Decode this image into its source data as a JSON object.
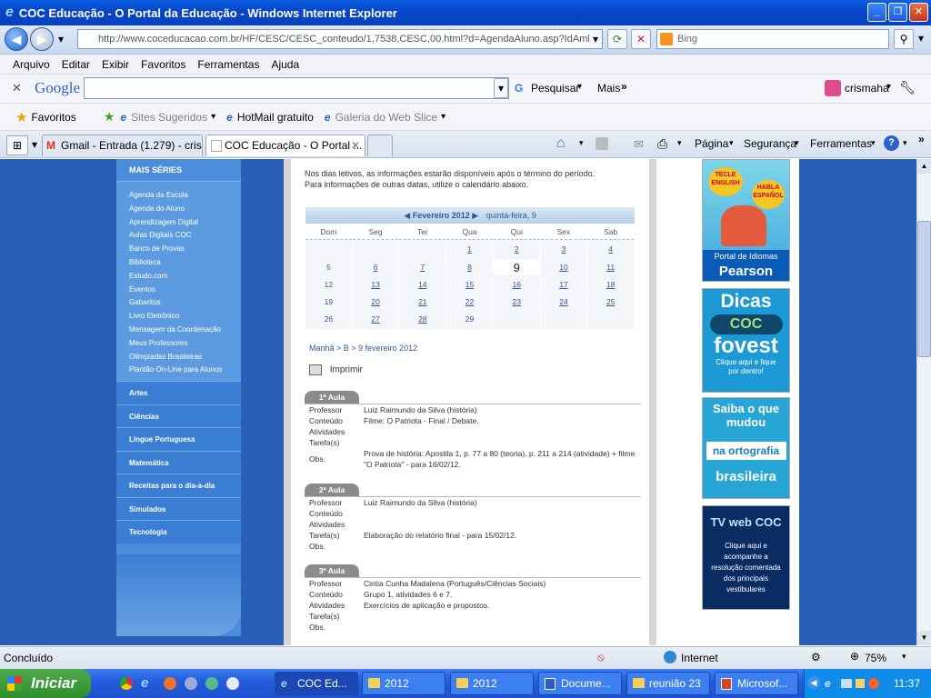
{
  "window": {
    "title": "COC Educação - O Portal da Educação - Windows Internet Explorer"
  },
  "address": {
    "url": "http://www.coceducacao.com.br/HF/CESC/CESC_conteudo/1,7538,CESC,00.html?d=AgendaAluno.asp?IdAmbi",
    "search_placeholder": "Bing"
  },
  "menu": [
    "Arquivo",
    "Editar",
    "Exibir",
    "Favoritos",
    "Ferramentas",
    "Ajuda"
  ],
  "google_toolbar": {
    "logo": "Google",
    "search_button": "Pesquisar",
    "more": "Mais",
    "user": "crismaha"
  },
  "favorites": {
    "favoritos": "Favoritos",
    "sites": "Sites Sugeridos",
    "hotmail": "HotMail gratuito",
    "galeria": "Galeria do Web Slice"
  },
  "tabs": [
    {
      "label": "Gmail - Entrada (1.279) - cris..."
    },
    {
      "label": "COC Educação - O Portal ..."
    }
  ],
  "command_bar": {
    "pagina": "Página",
    "seguranca": "Segurança",
    "ferramentas": "Ferramentas"
  },
  "sidebar": {
    "header": "MAIS SÉRIES",
    "items": [
      "Agenda da Escola",
      "Agenda do Aluno",
      "Aprendizagem Digital",
      "Aulas Digitais COC",
      "Banco de Provas",
      "Biblioteca",
      "Estudo.com",
      "Eventos",
      "Gabaritos",
      "Livro Eletrônico",
      "Mensagem da Coordenação",
      "Meus Professores",
      "Olimpíadas Brasileiras",
      "Plantão On-Line para Alunos"
    ],
    "categories": [
      "Artes",
      "Ciências",
      "Língue Portuguesa",
      "Matemática",
      "Receitas para o dia-a-dia",
      "Simulados",
      "Tecnologia"
    ]
  },
  "main": {
    "intro1": "Nos dias letivos, as informações estarão disponíveis após o término do período.",
    "intro2": "Para informações de outras datas, utilize o calendário abaixo.",
    "calendar": {
      "month": "Fevereiro 2012",
      "selected": "quinta-feira, 9",
      "weekdays": [
        "Dom",
        "Seg",
        "Ter",
        "Qua",
        "Qui",
        "Sex",
        "Sab"
      ],
      "weeks": [
        [
          "",
          "",
          "",
          "1",
          "2",
          "3",
          "4"
        ],
        [
          "5",
          "6",
          "7",
          "8",
          "9",
          "10",
          "11"
        ],
        [
          "12",
          "13",
          "14",
          "15",
          "16",
          "17",
          "18"
        ],
        [
          "19",
          "20",
          "21",
          "22",
          "23",
          "24",
          "25"
        ],
        [
          "26",
          "27",
          "28",
          "29",
          "",
          "",
          ""
        ]
      ]
    },
    "breadcrumb": "Manhã > B > 9 fevereiro 2012",
    "print": "Imprimir",
    "labels": {
      "professor": "Professor",
      "conteudo": "Conteúdo",
      "atividades": "Atividades",
      "tarefas": "Tarefa(s)",
      "obs": "Obs."
    },
    "aulas": [
      {
        "title": "1ª Aula",
        "professor": "Luiz Raimundo da Silva (história)",
        "conteudo": "Filme: O Patriota - Final / Debate.",
        "atividades": "",
        "tarefas": "",
        "obs": "Prova de história: Apostila 1, p. 77 a 80 (teoria), p. 211 a 214 (atividade) + filme \"O Patriota\" - para 16/02/12."
      },
      {
        "title": "2ª Aula",
        "professor": "Luiz Raimundo da Silva (história)",
        "conteudo": "",
        "atividades": "",
        "tarefas": "Elaboração do relatório final - para 15/02/12.",
        "obs": ""
      },
      {
        "title": "3ª Aula",
        "professor": "Cintia Cunha Madalena (Português/Ciências Sociais)",
        "conteudo": "Grupo 1, atividades 6 e 7.",
        "atividades": "Exercícios de aplicação e propostos.",
        "tarefas": "",
        "obs": ""
      }
    ]
  },
  "ads": {
    "ad1": {
      "top": "TECLE ENGLISH",
      "side": "HABLA ESPAÑOL",
      "line1": "Portal de Idiomas",
      "line2": "Pearson"
    },
    "ad2": {
      "line1": "Dicas",
      "brand": "COC",
      "line2": "fovest",
      "line3": "Clique aqui e fique por dentro!"
    },
    "ad3": {
      "line1": "Saiba o que mudou",
      "line2": "na ortografia",
      "line3": "brasileira"
    },
    "ad4": {
      "line1": "TV web COC",
      "line2": "Clique aqui e acompanhe a resolução comentada dos principais vestibulares"
    }
  },
  "status": {
    "text": "Concluído",
    "zone": "Internet",
    "zoom": "75%"
  },
  "taskbar": {
    "start": "Iniciar",
    "items": [
      "COC Ed...",
      "2012",
      "2012",
      "Docume...",
      "reunião 23",
      "Microsof..."
    ],
    "clock": "11:37"
  }
}
